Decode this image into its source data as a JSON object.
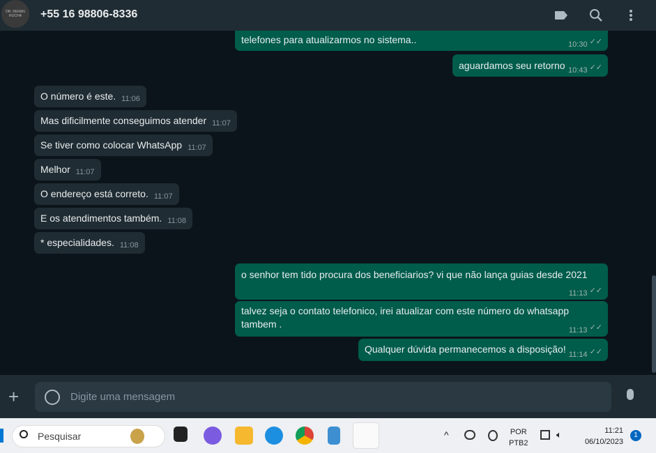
{
  "header": {
    "contact": "+55 16 98806-8336",
    "avatar_text": "DR. RENAN ROCHA"
  },
  "messages": [
    {
      "dir": "out",
      "text": "telefones para atualizarmos no sistema..",
      "time": "10:30"
    },
    {
      "dir": "out",
      "text": "aguardamos seu retorno",
      "time": "10:43"
    },
    {
      "dir": "in",
      "text": "O número é este.",
      "time": "11:06"
    },
    {
      "dir": "in",
      "text": "Mas dificilmente conseguimos atender",
      "time": "11:07"
    },
    {
      "dir": "in",
      "text": "Se tiver como colocar WhatsApp",
      "time": "11:07"
    },
    {
      "dir": "in",
      "text": "Melhor",
      "time": "11:07"
    },
    {
      "dir": "in",
      "text": "O endereço está correto.",
      "time": "11:07"
    },
    {
      "dir": "in",
      "text": "E os atendimentos também.",
      "time": "11:08"
    },
    {
      "dir": "in",
      "text": "* especialidades.",
      "time": "11:08"
    },
    {
      "dir": "out",
      "text": "o senhor tem tido procura dos beneficiarios? vi que não lança guias desde 2021",
      "time": "11:13"
    },
    {
      "dir": "out",
      "text": "talvez seja o contato telefonico, irei atualizar com este número do whatsapp tambem .",
      "time": "11:13"
    },
    {
      "dir": "out",
      "text": "Qualquer dúvida permanecemos a disposição!",
      "time": "11:14"
    }
  ],
  "ticks": "✓✓",
  "composer": {
    "placeholder": "Digite uma mensagem"
  },
  "taskbar": {
    "search": "Pesquisar",
    "lang1": "POR",
    "lang2": "PTB2",
    "time": "11:21",
    "date": "06/10/2023",
    "badge": "1"
  }
}
